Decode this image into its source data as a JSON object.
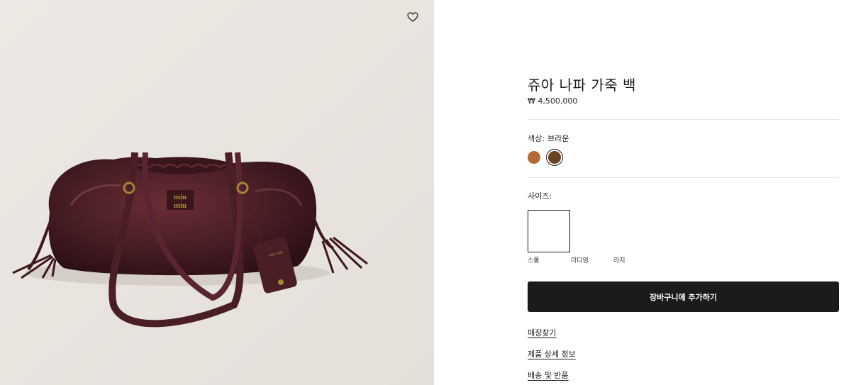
{
  "product": {
    "title": "쥬아 나파 가죽 백",
    "price": "₩ 4,500,000"
  },
  "color": {
    "label": "색상:",
    "selected": "브라운",
    "swatches": [
      {
        "name": "caramel",
        "hex": "#b46a34"
      },
      {
        "name": "brown",
        "hex": "#6b4423",
        "selected": true
      }
    ]
  },
  "size": {
    "label": "사이즈:",
    "options": [
      "스몰",
      "미디엄",
      "라지"
    ],
    "selected": "스몰"
  },
  "cart_button": "장바구니에 추가하기",
  "links": [
    "매장찾기",
    "제품 상세 정보",
    "배송 및 반품"
  ],
  "image": {
    "logo_text": "miu miu",
    "background": "#ebe7e2",
    "bag_color": "#4a1e25"
  },
  "icons": {
    "wishlist": "heart-icon"
  }
}
